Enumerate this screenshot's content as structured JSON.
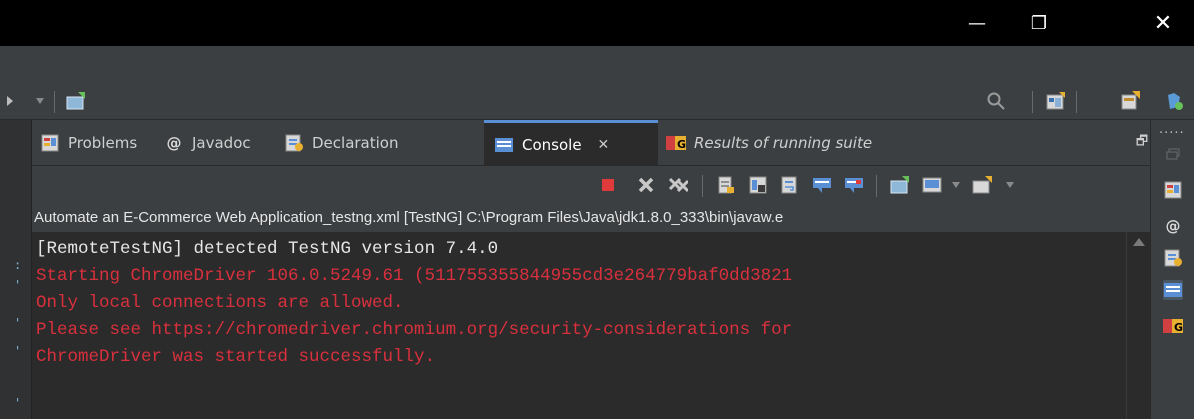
{
  "window": {
    "minimize_glyph": "—",
    "maximize_glyph": "❐",
    "close_glyph": "✕"
  },
  "tabs": [
    {
      "label": "Problems",
      "icon": "problems-icon"
    },
    {
      "label": "Javadoc",
      "icon": "javadoc-icon"
    },
    {
      "label": "Declaration",
      "icon": "declaration-icon"
    },
    {
      "label": "Console",
      "icon": "console-icon",
      "active": true
    },
    {
      "label": "Results of running suite",
      "icon": "testng-icon"
    }
  ],
  "console": {
    "description": "Automate an E-Commerce Web Application_testng.xml [TestNG] C:\\Program Files\\Java\\jdk1.8.0_333\\bin\\javaw.e",
    "lines": [
      {
        "text": "[RemoteTestNG] detected TestNG version 7.4.0",
        "stream": "stdout"
      },
      {
        "text": "Starting ChromeDriver 106.0.5249.61 (511755355844955cd3e264779baf0dd3821",
        "stream": "stderr"
      },
      {
        "text": "Only local connections are allowed.",
        "stream": "stderr"
      },
      {
        "text": "Please see https://chromedriver.chromium.org/security-considerations for",
        "stream": "stderr"
      },
      {
        "text": "ChromeDriver was started successfully.",
        "stream": "stderr"
      }
    ]
  },
  "colors": {
    "stderr": "#d9303d",
    "stdout": "#e6e6e6",
    "accent": "#5a8fd6",
    "background": "#2b2b2b"
  }
}
